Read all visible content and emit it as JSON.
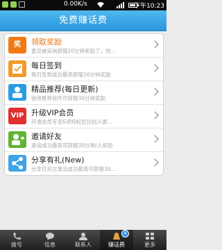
{
  "statusbar": {
    "net_speed": "0.00K/s",
    "time": "下午10:23"
  },
  "header": {
    "title": "免费赚话费"
  },
  "items": [
    {
      "icon": "prize-icon",
      "glyph": "奖",
      "color": "#f07a14",
      "title": "领取奖励",
      "desc": "意见被采纳获赠20分钟奖励了，快..."
    },
    {
      "icon": "signin-icon",
      "glyph": "",
      "color": "#f09a2a",
      "title": "每日签到",
      "desc": "每日签到成功最高获赠16分钟奖励"
    },
    {
      "icon": "recommend-icon",
      "glyph": "",
      "color": "#2c9be0",
      "title": "精品推荐(每日更新)",
      "desc": "使用推荐软件可获赠30分钟奖励"
    },
    {
      "icon": "vip-icon",
      "glyph": "VIP",
      "color": "#e03030",
      "title": "升级VIP会员",
      "desc": "开通会员专享6项特权您比别人更..."
    },
    {
      "icon": "invite-icon",
      "glyph": "",
      "color": "#5fb431",
      "title": "邀请好友",
      "desc": "邀请成功最高可获赠30分钟/人奖励"
    },
    {
      "icon": "share-icon",
      "glyph": "",
      "color": "#3fa3e8",
      "title": "分享有礼(New)",
      "desc": "分享日对方激活成功最高可获赠30..."
    }
  ],
  "tabs": [
    {
      "label": "拨号",
      "icon": "phone-icon"
    },
    {
      "label": "信息",
      "icon": "message-icon"
    },
    {
      "label": "联系人",
      "icon": "contacts-icon"
    },
    {
      "label": "赚话费",
      "icon": "earn-icon",
      "badge": "6"
    },
    {
      "label": "更多",
      "icon": "more-icon"
    }
  ]
}
